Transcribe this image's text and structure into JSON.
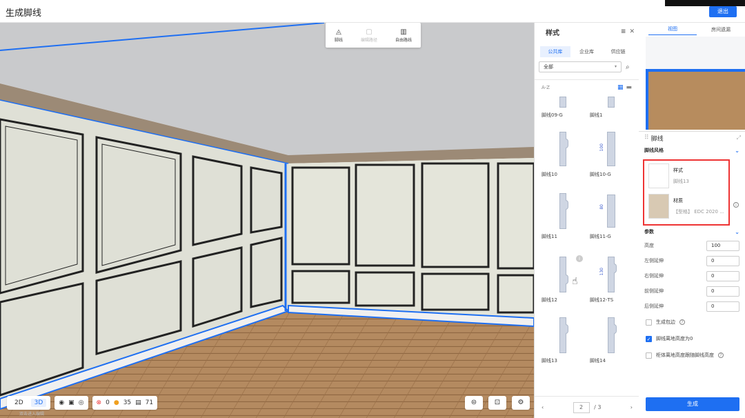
{
  "app": {
    "title": "生成脚线",
    "exit_label": "退出"
  },
  "toolbar": {
    "items": [
      {
        "icon": "baseboard-icon",
        "label": "脚线"
      },
      {
        "icon": "edit-path-icon",
        "label": "编辑路径"
      },
      {
        "icon": "custom-path-icon",
        "label": "自由路线"
      }
    ]
  },
  "view_controls": {
    "mode_2d": "2D",
    "mode_3d": "3D",
    "errors": "0",
    "warnings": "35",
    "items": "71",
    "faint_hint": "双击进入编辑"
  },
  "style_panel": {
    "title": "样式",
    "tabs": [
      "公共库",
      "企业库",
      "供应链"
    ],
    "filter": "全部",
    "sort_label": "A-Z",
    "cards": [
      {
        "label": "脚线09-G"
      },
      {
        "label": "脚线1"
      },
      {
        "label": "脚线10"
      },
      {
        "label": "脚线10-G",
        "dim": "100"
      },
      {
        "label": "脚线11"
      },
      {
        "label": "脚线11-G",
        "dim": "80"
      },
      {
        "label": "脚线12"
      },
      {
        "label": "脚线12-TS",
        "dim": "130"
      },
      {
        "label": "脚线13"
      },
      {
        "label": "脚线14"
      }
    ],
    "page_current": "2",
    "page_total": "/ 3"
  },
  "right_tabs": [
    "视图",
    "房间遗漏"
  ],
  "props": {
    "title": "脚线",
    "section_style": "脚线风格",
    "style_item": {
      "title": "样式",
      "value": "脚线13"
    },
    "material_item": {
      "title": "材质",
      "value": "【型格】 EDC 2020 ..."
    },
    "section_params": "参数",
    "params": [
      {
        "label": "高度",
        "value": "100"
      },
      {
        "label": "左侧延伸",
        "value": "0"
      },
      {
        "label": "右侧延伸",
        "value": "0"
      },
      {
        "label": "前侧延伸",
        "value": "0"
      },
      {
        "label": "后侧延伸",
        "value": "0"
      }
    ],
    "checks": [
      {
        "label": "生成包边",
        "checked": false
      },
      {
        "label": "脚线离地高度为0",
        "checked": true
      },
      {
        "label": "柜体离地高度跟随脚线高度",
        "checked": false
      }
    ],
    "generate_label": "生成"
  }
}
